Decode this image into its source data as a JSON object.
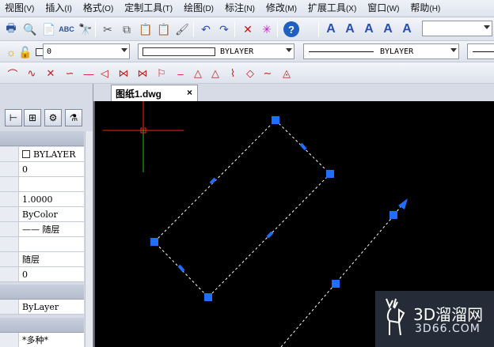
{
  "menubar": {
    "items": [
      {
        "label": "视图",
        "key": "(V)"
      },
      {
        "label": "插入",
        "key": "(I)"
      },
      {
        "label": "格式",
        "key": "(O)"
      },
      {
        "label": "定制工具",
        "key": "(T)"
      },
      {
        "label": "绘图",
        "key": "(D)"
      },
      {
        "label": "标注",
        "key": "(N)"
      },
      {
        "label": "修改",
        "key": "(M)"
      },
      {
        "label": "扩展工具",
        "key": "(X)"
      },
      {
        "label": "窗口",
        "key": "(W)"
      },
      {
        "label": "帮助",
        "key": "(H)"
      }
    ]
  },
  "toolbar_standard": {
    "icons": [
      "print-icon",
      "print-preview-icon",
      "publish-icon",
      "spellcheck-icon",
      "find-icon",
      "cut-icon",
      "copy-icon",
      "paste-icon",
      "paste-special-icon",
      "match-properties-icon",
      "undo-icon",
      "redo-icon",
      "erase-icon",
      "purge-icon",
      "help-icon",
      "text-style-icon",
      "text-icon",
      "text-edit-icon",
      "text-find-icon",
      "text-scale-icon"
    ],
    "glyphs": [
      "🖶",
      "🔍",
      "📄",
      "ABC",
      "🔭",
      "✂",
      "⧉",
      "📋",
      "📋",
      "🖌",
      "↶",
      "↷",
      "✕",
      "✳",
      "?",
      "A",
      "A",
      "A",
      "A",
      "A"
    ],
    "text_style_value": ""
  },
  "toolbar_layers": {
    "layer_value": "0",
    "color_value": "BYLAYER",
    "linetype_value": "BYLAYER"
  },
  "toolbar_dimension": {
    "icons": [
      "arc-icon",
      "wave-icon",
      "cross-icon",
      "curve-icon",
      "line-icon",
      "angle-icon",
      "bowtie-icon",
      "ribbon-icon",
      "flag-icon",
      "dash-icon",
      "triangle-icon",
      "triangle-alt-icon",
      "fold-icon",
      "diamond-icon",
      "spline-icon",
      "tri-arrow-icon"
    ],
    "glyphs": [
      "⌒",
      "∿",
      "✕",
      "∽",
      "—",
      "◁",
      "⋈",
      "⋈",
      "⚐",
      "‒",
      "△",
      "△",
      "⌇",
      "◇",
      "∼",
      "◬"
    ]
  },
  "tabs": [
    {
      "label": "图纸1.dwg",
      "close": "×"
    }
  ],
  "properties_panel": {
    "tool_icons": [
      "select-objects-icon",
      "quick-select-icon",
      "toggle-pickadd-icon",
      "filter-icon"
    ],
    "tool_glyphs": [
      "⊢",
      "⊞",
      "⚙",
      "⚗"
    ],
    "rows": [
      {
        "value": "BYLAYER",
        "checkbox": true
      },
      {
        "value": "0"
      },
      {
        "value": ""
      },
      {
        "value": "1.0000"
      },
      {
        "value": "ByColor"
      },
      {
        "value": "—— 随层"
      },
      {
        "value": ""
      },
      {
        "value": "随层"
      },
      {
        "value": "0"
      },
      {
        "value": "ByLayer"
      },
      {
        "value": "*多种*"
      }
    ]
  },
  "canvas": {
    "background": "#000000",
    "line_color": "#ffffff",
    "grip_color": "#1e6fff",
    "crosshair_x_color": "#ff2020",
    "crosshair_y_color": "#20c020"
  },
  "watermark": {
    "brand": "3D溜溜网",
    "domain": "3D66.COM"
  }
}
